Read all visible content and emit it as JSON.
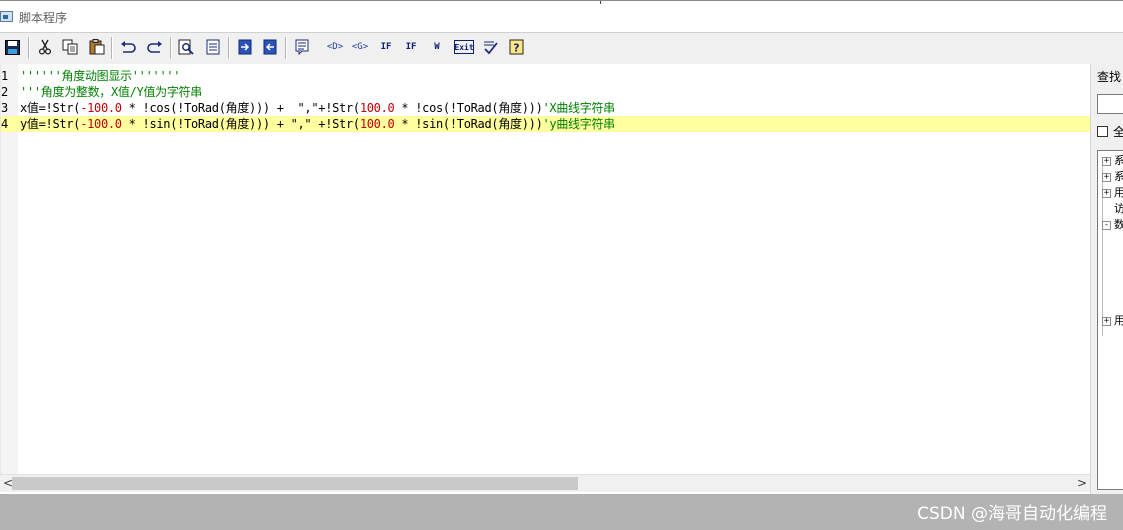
{
  "window": {
    "title": "脚本程序"
  },
  "toolbar": {
    "buttons": [
      {
        "name": "save-icon",
        "kind": "icon"
      },
      {
        "name": "cut-icon",
        "kind": "icon"
      },
      {
        "name": "copy-icon",
        "kind": "icon"
      },
      {
        "name": "paste-icon",
        "kind": "icon"
      },
      {
        "name": "undo-icon",
        "kind": "icon"
      },
      {
        "name": "redo-icon",
        "kind": "icon"
      },
      {
        "name": "find-icon",
        "kind": "icon"
      },
      {
        "name": "replace-icon",
        "kind": "icon"
      },
      {
        "name": "indent-icon",
        "kind": "icon"
      },
      {
        "name": "outdent-icon",
        "kind": "icon"
      },
      {
        "name": "comment-icon",
        "kind": "icon"
      }
    ],
    "labels": {
      "d": "<D>",
      "g": "<G>",
      "if1": "IF",
      "if2": "IF",
      "while": "W",
      "exit": "Exit"
    }
  },
  "editor": {
    "lines": [
      {
        "no": "1",
        "parts": [
          {
            "t": "''''''角度动图显示'''''''",
            "c": "cm"
          }
        ]
      },
      {
        "no": "2",
        "parts": [
          {
            "t": "'''角度为整数，X值/Y值为字符串",
            "c": "cm"
          }
        ]
      },
      {
        "no": "3",
        "parts": [
          {
            "t": "x值=!Str(",
            "c": "kw"
          },
          {
            "t": "-100.0",
            "c": "num"
          },
          {
            "t": " * !cos(!ToRad(角度))) +  \",\"+!Str(",
            "c": "kw"
          },
          {
            "t": "100.0",
            "c": "num"
          },
          {
            "t": " * !cos(!ToRad(角度)))",
            "c": "kw"
          },
          {
            "t": "'X曲线字符串",
            "c": "cm"
          }
        ]
      },
      {
        "no": "4",
        "highlight": true,
        "parts": [
          {
            "t": "y值=!Str(",
            "c": "kw"
          },
          {
            "t": "-100.0",
            "c": "num"
          },
          {
            "t": " * !sin(!ToRad(角度))) + \",\" +!Str(",
            "c": "kw"
          },
          {
            "t": "100.0",
            "c": "num"
          },
          {
            "t": " * !sin(!ToRad(角度)))",
            "c": "kw"
          },
          {
            "t": "'y曲线字符串",
            "c": "cm"
          }
        ]
      }
    ]
  },
  "sidepanel": {
    "find_label": "查找",
    "checkbox_label": "全",
    "tree": [
      {
        "box": "+",
        "label": "系"
      },
      {
        "box": "+",
        "label": "系"
      },
      {
        "box": "+",
        "label": "用"
      },
      {
        "box": "",
        "label": "访"
      },
      {
        "box": "-",
        "label": "数"
      },
      {
        "box": "",
        "label": ""
      },
      {
        "box": "",
        "label": ""
      },
      {
        "box": "",
        "label": ""
      },
      {
        "box": "",
        "label": ""
      },
      {
        "box": "",
        "label": ""
      },
      {
        "box": "+",
        "label": "用"
      }
    ]
  },
  "scrollbar": {
    "left_arrow": "<",
    "right_arrow": ">"
  },
  "watermark": "CSDN @海哥自动化编程",
  "colors": {
    "highlight": "#ffffa0",
    "comment": "#008000",
    "number": "#c00000",
    "status_bg": "#b3b3b3"
  }
}
